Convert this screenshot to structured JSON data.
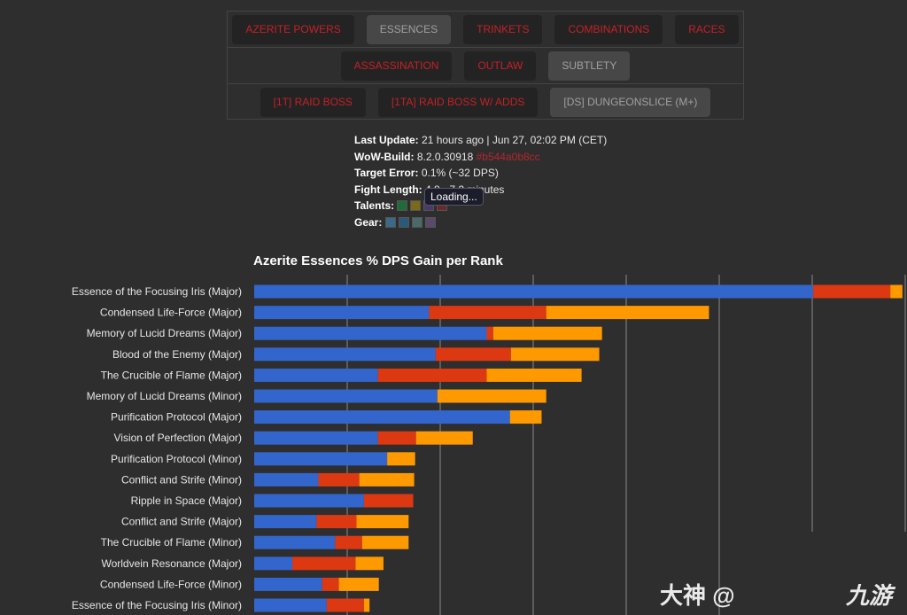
{
  "nav": {
    "row1": [
      {
        "label": "AZERITE POWERS",
        "active": false
      },
      {
        "label": "ESSENCES",
        "active": true
      },
      {
        "label": "TRINKETS",
        "active": false
      },
      {
        "label": "COMBINATIONS",
        "active": false
      },
      {
        "label": "RACES",
        "active": false
      }
    ],
    "row2": [
      {
        "label": "ASSASSINATION",
        "active": false
      },
      {
        "label": "OUTLAW",
        "active": false
      },
      {
        "label": "SUBTLETY",
        "active": true
      }
    ],
    "row3": [
      {
        "label": "[1T] RAID BOSS",
        "active": false
      },
      {
        "label": "[1TA] RAID BOSS W/ ADDS",
        "active": false
      },
      {
        "label": "[DS] DUNGEONSLICE (M+)",
        "active": true
      }
    ]
  },
  "info": {
    "last_update_label": "Last Update:",
    "last_update": "21 hours ago | Jun 27, 02:02 PM (CET)",
    "build_label": "WoW-Build:",
    "build": "8.2.0.30918",
    "build_hash": "#b544a0b8cc",
    "error_label": "Target Error:",
    "error": "0.1% (~32 DPS)",
    "fight_label": "Fight Length:",
    "fight": "4.8 - 7.2 minutes",
    "talents_label": "Talents:",
    "gear_label": "Gear:",
    "tooltip": "Loading..."
  },
  "watermark": {
    "left": "大神 @",
    "right": "九游"
  },
  "chart_data": {
    "type": "bar",
    "orientation": "horizontal",
    "stacked": true,
    "title": "Azerite Essences % DPS Gain per Rank",
    "grid": true,
    "colors": [
      "#3366cc",
      "#dc3912",
      "#ff9900"
    ],
    "categories": [
      "Essence of the Focusing Iris (Major)",
      "Condensed Life-Force (Major)",
      "Memory of Lucid Dreams (Major)",
      "Blood of the Enemy (Major)",
      "The Crucible of Flame (Major)",
      "Memory of Lucid Dreams (Minor)",
      "Purification Protocol (Major)",
      "Vision of Perfection (Major)",
      "Purification Protocol (Minor)",
      "Conflict and Strife (Minor)",
      "Ripple in Space (Major)",
      "Conflict and Strife (Major)",
      "The Crucible of Flame (Minor)",
      "Worldvein Resonance (Major)",
      "Condensed Life-Force (Minor)",
      "Essence of the Focusing Iris (Minor)"
    ],
    "series": [
      {
        "values": [
          6.01,
          1.88,
          2.5,
          1.95,
          1.33,
          1.97,
          2.75,
          1.33,
          1.43,
          0.69,
          1.18,
          0.67,
          0.87,
          0.41,
          0.73,
          0.78
        ]
      },
      {
        "values": [
          0.83,
          1.26,
          0.07,
          0.81,
          1.17,
          0,
          0,
          0.41,
          0,
          0.44,
          0.53,
          0.43,
          0.29,
          0.68,
          0.18,
          0.4
        ]
      },
      {
        "values": [
          0.13,
          1.75,
          1.17,
          0.95,
          1.02,
          1.17,
          0.34,
          0.61,
          0.3,
          0.59,
          0,
          0.56,
          0.5,
          0.3,
          0.43,
          0.06
        ]
      }
    ],
    "xlim": [
      0,
      7
    ]
  }
}
